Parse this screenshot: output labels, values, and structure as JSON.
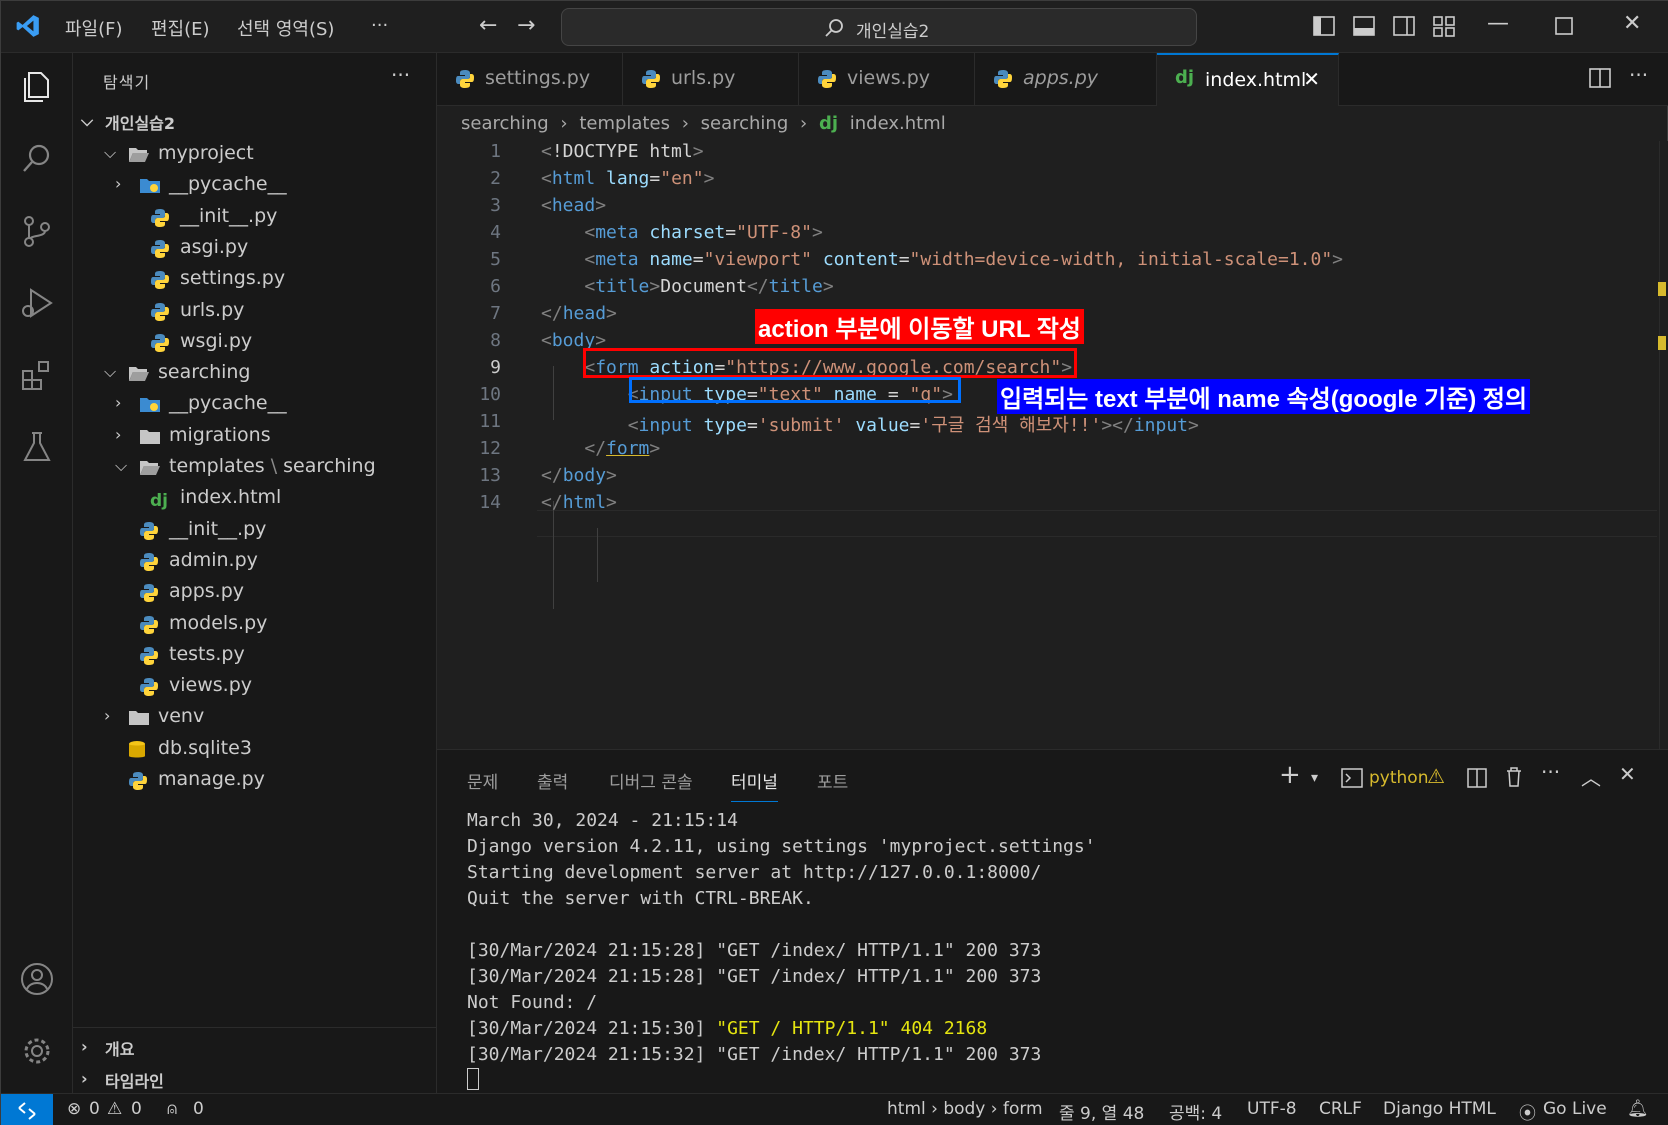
{
  "menu": [
    "파일(F)",
    "편집(E)",
    "선택 영역(S)",
    "···"
  ],
  "search": {
    "text": "개인실습2"
  },
  "sidebar": {
    "title": "탐색기",
    "more": "···",
    "root": "개인실습2",
    "items": [
      {
        "label": "myproject",
        "type": "folder-open"
      },
      {
        "label": "__pycache__",
        "type": "folder-py"
      },
      {
        "label": "__init__.py",
        "type": "python"
      },
      {
        "label": "asgi.py",
        "type": "python"
      },
      {
        "label": "settings.py",
        "type": "python"
      },
      {
        "label": "urls.py",
        "type": "python"
      },
      {
        "label": "wsgi.py",
        "type": "python"
      },
      {
        "label": "searching",
        "type": "folder-open"
      },
      {
        "label": "__pycache__",
        "type": "folder-py"
      },
      {
        "label": "migrations",
        "type": "folder"
      },
      {
        "label": "templates",
        "label2": "searching",
        "type": "folder-open"
      },
      {
        "label": "index.html",
        "type": "django"
      },
      {
        "label": "__init__.py",
        "type": "python"
      },
      {
        "label": "admin.py",
        "type": "python"
      },
      {
        "label": "apps.py",
        "type": "python"
      },
      {
        "label": "models.py",
        "type": "python"
      },
      {
        "label": "tests.py",
        "type": "python"
      },
      {
        "label": "views.py",
        "type": "python"
      },
      {
        "label": "venv",
        "type": "folder"
      },
      {
        "label": "db.sqlite3",
        "type": "database"
      },
      {
        "label": "manage.py",
        "type": "python"
      }
    ],
    "outline": "개요",
    "timeline": "타임라인"
  },
  "tabs": [
    {
      "label": "settings.py"
    },
    {
      "label": "urls.py"
    },
    {
      "label": "views.py"
    },
    {
      "label": "apps.py"
    },
    {
      "label": "index.html",
      "close": "✕"
    }
  ],
  "breadcrumb": {
    "parts": [
      "searching",
      "templates",
      "searching"
    ],
    "file": "index.html",
    "dj": "dj",
    "sep": "›"
  },
  "editor": {
    "line_numbers": [
      "1",
      "2",
      "3",
      "4",
      "5",
      "6",
      "7",
      "8",
      "9",
      "10",
      "11",
      "12",
      "13",
      "14"
    ],
    "annotations": {
      "red": "action 부분에 이동할 URL 작성",
      "blue": "입력되는 text 부분에 name 속성(google 기준) 정의"
    }
  },
  "panel": {
    "tabs": [
      "문제",
      "출력",
      "디버그 콘솔",
      "터미널",
      "포트"
    ],
    "terminal_name": "python",
    "terminal": [
      "March 30, 2024 - 21:15:14",
      "Django version 4.2.11, using settings 'myproject.settings'",
      "Starting development server at http://127.0.0.1:8000/",
      "Quit the server with CTRL-BREAK.",
      "",
      "[30/Mar/2024 21:15:28] \"GET /index/ HTTP/1.1\" 200 373",
      "[30/Mar/2024 21:15:28] \"GET /index/ HTTP/1.1\" 200 373",
      "Not Found: /",
      "[30/Mar/2024 21:15:30] ",
      "[30/Mar/2024 21:15:32] \"GET /index/ HTTP/1.1\" 200 373"
    ],
    "terminal_highlight": "\"GET / HTTP/1.1\" 404 2168"
  },
  "statusbar": {
    "errors": "0",
    "warnings": "0",
    "ports": "0",
    "path": "html › body › form",
    "position": "줄 9, 열 48",
    "spaces": "공백: 4",
    "encoding": "UTF-8",
    "eol": "CRLF",
    "language": "Django HTML",
    "golive": "Go Live"
  },
  "colors": {
    "accent": "#0078d4",
    "red_annotation": "#ff0000",
    "blue_annotation": "#0000ff"
  }
}
